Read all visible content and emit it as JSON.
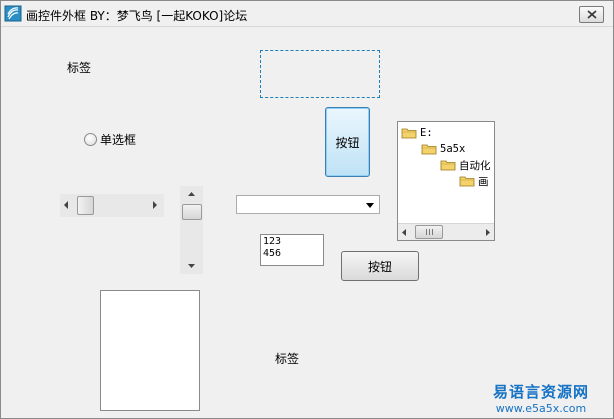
{
  "window": {
    "title": "画控件外框   BY：梦飞鸟    [一起KOKO]论坛"
  },
  "controls": {
    "label_top": "标签",
    "label_bottom": "标签",
    "radio_label": "单选框",
    "button_tall": "按钮",
    "button_wide": "按钮",
    "memo_lines": [
      "123",
      "456"
    ],
    "combo_value": ""
  },
  "tree": {
    "items": [
      {
        "label": "E:",
        "level": 0
      },
      {
        "label": "5a5x",
        "level": 1
      },
      {
        "label": "自动化",
        "level": 2
      },
      {
        "label": "画",
        "level": 3
      }
    ]
  },
  "watermark": {
    "cn": "易语言资源网",
    "url": "www.e5a5x.com"
  },
  "colors": {
    "frame_accent": "#1c7fb8",
    "watermark": "#1572c4",
    "folder": "#f3d26b"
  },
  "icons": {
    "app": "app-icon",
    "close": "close-icon",
    "folder": "folder-icon"
  }
}
